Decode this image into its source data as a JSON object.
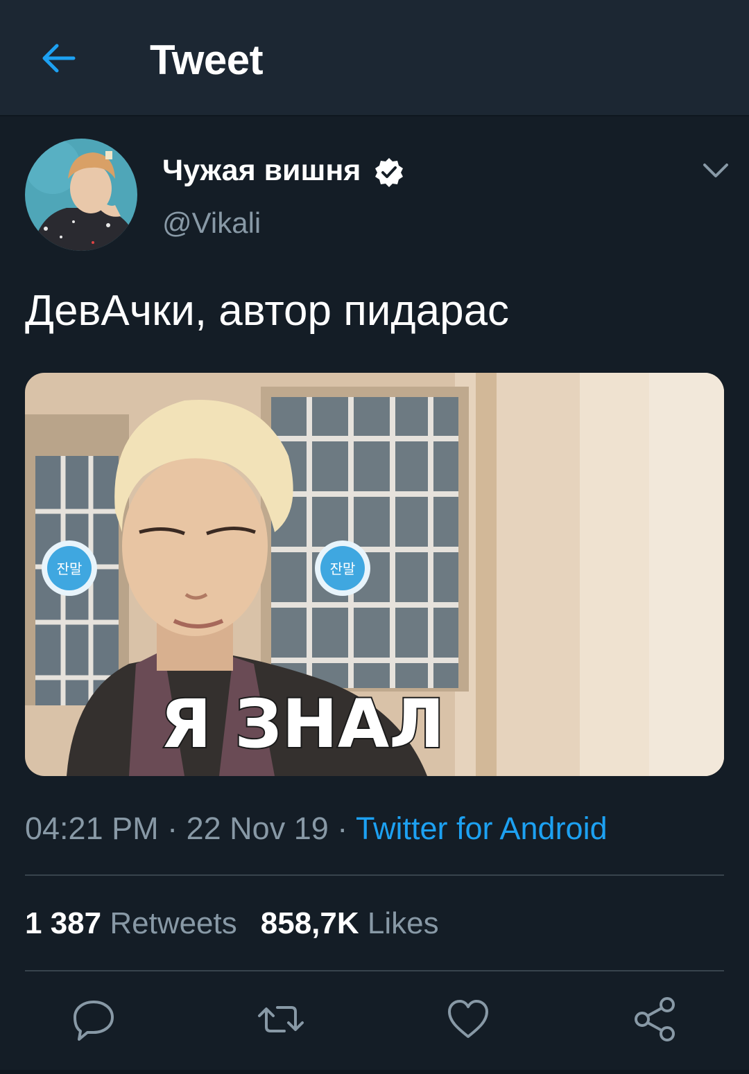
{
  "header": {
    "title": "Tweet"
  },
  "user": {
    "display_name": "Чужая вишня",
    "handle": "@Vikali"
  },
  "tweet": {
    "text": "ДевАчки, автор пидарас",
    "media_caption": "Я ЗНАЛ",
    "media_sticker_text": "잔말",
    "time": "04:21 PM",
    "date": "22 Nov 19",
    "separator": " · ",
    "source": "Twitter for Android"
  },
  "stats": {
    "retweets_count": "1 387",
    "retweets_label": "Retweets",
    "likes_count": "858,7K",
    "likes_label": "Likes"
  },
  "colors": {
    "background": "#141d26",
    "header": "#1c2733",
    "text_secondary": "#8899a6",
    "accent": "#1da1f2",
    "divider": "#38444d"
  },
  "icons": [
    "back-arrow-icon",
    "verified-badge-icon",
    "chevron-down-icon",
    "reply-icon",
    "retweet-icon",
    "like-icon",
    "share-icon"
  ]
}
